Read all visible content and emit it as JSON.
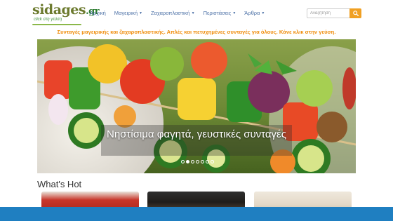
{
  "logo": {
    "main": "sidages",
    "suffix": ".gr",
    "sub": "click στη γεύση",
    "brand_color": "#6c7a2e"
  },
  "nav": {
    "items": [
      {
        "label": "Αρχική",
        "has_dropdown": false
      },
      {
        "label": "Μαγειρική",
        "has_dropdown": true
      },
      {
        "label": "Ζαχαροπλαστική",
        "has_dropdown": true
      },
      {
        "label": "Περιστάσεις",
        "has_dropdown": true
      },
      {
        "label": "Άρθρα",
        "has_dropdown": true
      }
    ],
    "link_color": "#4a6fa5"
  },
  "search": {
    "placeholder": "Αναζήτηση",
    "button_icon": "search-icon",
    "button_color": "#f0a023"
  },
  "tagline": "Συνταγές μαγειρικής και ζαχαροπλαστικής. Απλές και πετυχημένες συνταγές για όλους. Κάνε κλικ στην γεύση.",
  "carousel": {
    "caption": "Νηστίσιμα φαγητά, γευστικές συνταγές",
    "slide_count": 7,
    "active_slide": 2
  },
  "section": {
    "title": "What's Hot"
  },
  "accent_bar_color": "#1f7fc1"
}
